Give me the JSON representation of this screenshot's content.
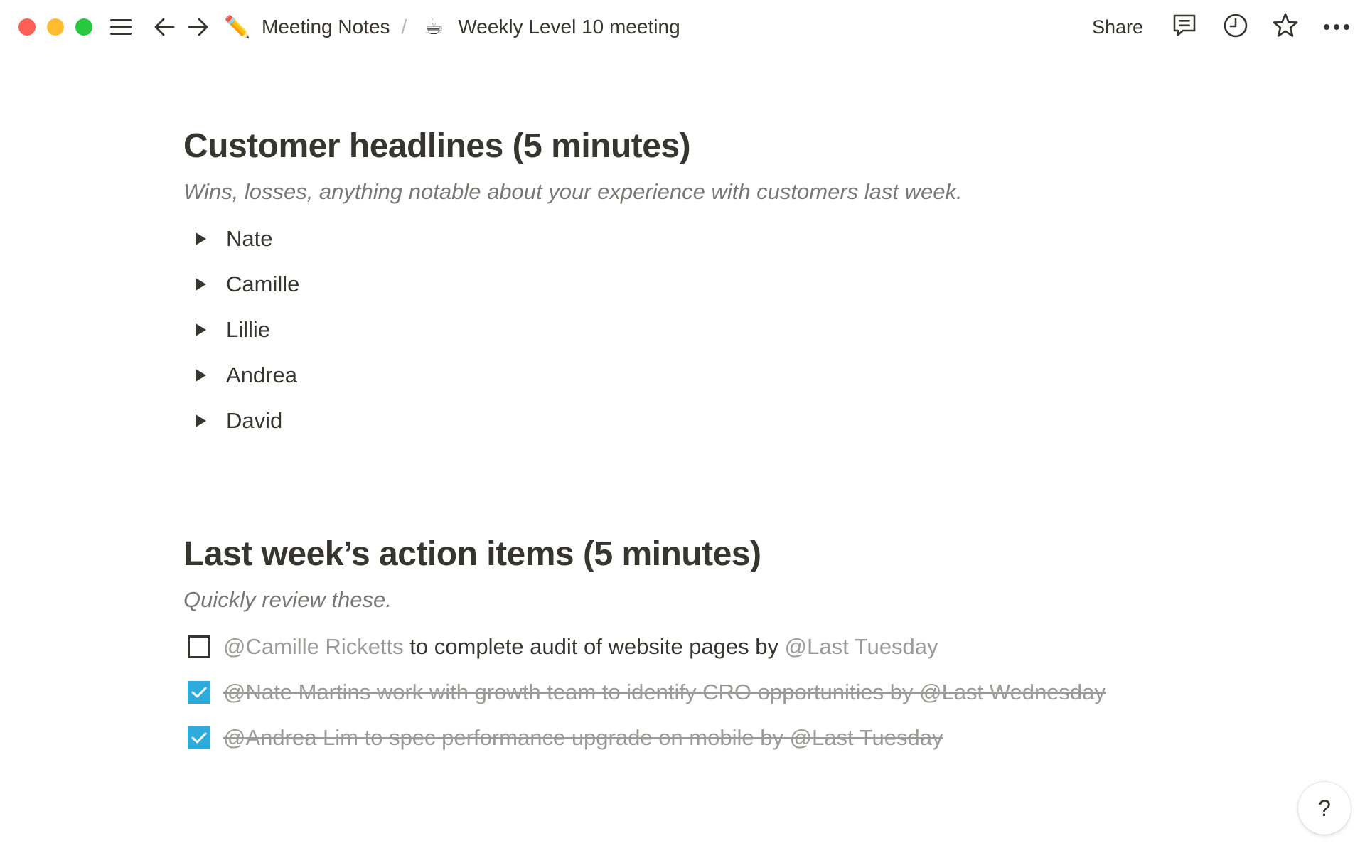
{
  "window": {
    "traffic_lights": [
      "close",
      "minimize",
      "zoom"
    ]
  },
  "topbar": {
    "icons": {
      "menu": "hamburger-menu-icon",
      "back": "arrow-left-icon",
      "forward": "arrow-right-icon",
      "comments": "comment-icon",
      "updates": "clock-icon",
      "favorite": "star-icon",
      "more": "more-horizontal-icon"
    },
    "breadcrumb": [
      {
        "emoji": "✏️",
        "label": "Meeting Notes"
      },
      {
        "emoji": "☕",
        "label": "Weekly Level 10 meeting"
      }
    ],
    "separator": "/",
    "share_label": "Share"
  },
  "sections": [
    {
      "heading": "Customer headlines (5 minutes)",
      "description": "Wins, losses, anything notable about your experience with customers last week.",
      "toggles": [
        "Nate",
        "Camille",
        "Lillie",
        "Andrea",
        "David"
      ]
    },
    {
      "heading": "Last week’s action items (5 minutes)",
      "description": "Quickly review these.",
      "todos": [
        {
          "checked": false,
          "mention": "@Camille Ricketts",
          "text": " to complete audit of website pages by ",
          "date": "@Last Tuesday"
        },
        {
          "checked": true,
          "mention": "@Nate Martins",
          "text": " work with growth team to identify CRO opportunities by ",
          "date": "@Last Wednesday"
        },
        {
          "checked": true,
          "mention": "@Andrea Lim",
          "text": " to spec performance upgrade on mobile by ",
          "date": "@Last Tuesday"
        }
      ]
    }
  ],
  "help_label": "?",
  "colors": {
    "text": "#37352f",
    "muted": "#9b9a97",
    "description": "#787774",
    "checkbox_checked": "#2eaadc",
    "traffic_red": "#fe5f57",
    "traffic_yellow": "#febc2e",
    "traffic_green": "#28c840"
  }
}
